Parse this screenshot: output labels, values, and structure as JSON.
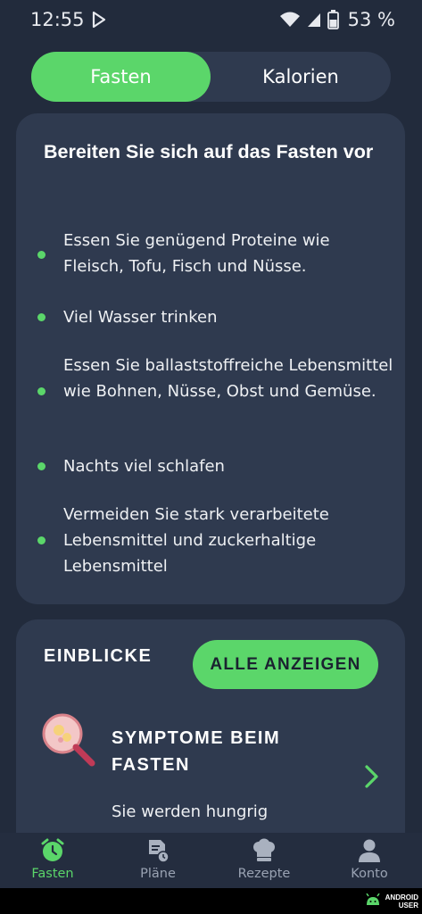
{
  "status_bar": {
    "time": "12:55",
    "battery_percent": "53 %"
  },
  "toggle": {
    "active_label": "Fasten",
    "inactive_label": "Kalorien"
  },
  "prep_card": {
    "title": "Bereiten Sie sich auf das Fasten vor",
    "tips": [
      "Essen Sie genügend Proteine wie Fleisch, Tofu, Fisch und Nüsse.",
      "Viel Wasser trinken",
      "Essen Sie ballaststoffreiche Lebensmittel wie Bohnen, Nüsse, Obst und Gemüse.",
      "Nachts viel schlafen",
      "Vermeiden Sie stark verarbeitete Lebensmittel und zuckerhaltige Lebensmittel"
    ]
  },
  "insights": {
    "title": "EINBLICKE",
    "show_all_label": "ALLE ANZEIGEN",
    "item": {
      "title": "SYMPTOME BEIM FASTEN",
      "text": "Sie werden hungrig"
    }
  },
  "bottom_nav": {
    "items": [
      {
        "label": "Fasten",
        "icon": "fasting-clock-icon",
        "active": true
      },
      {
        "label": "Pläne",
        "icon": "plans-document-icon",
        "active": false
      },
      {
        "label": "Rezepte",
        "icon": "chef-hat-icon",
        "active": false
      },
      {
        "label": "Konto",
        "icon": "account-person-icon",
        "active": false
      }
    ]
  },
  "watermark": {
    "line1": "ANDROID",
    "line2": "USER"
  },
  "colors": {
    "accent": "#5bd66a",
    "background": "#222b3c",
    "card": "#2f3a4f"
  }
}
